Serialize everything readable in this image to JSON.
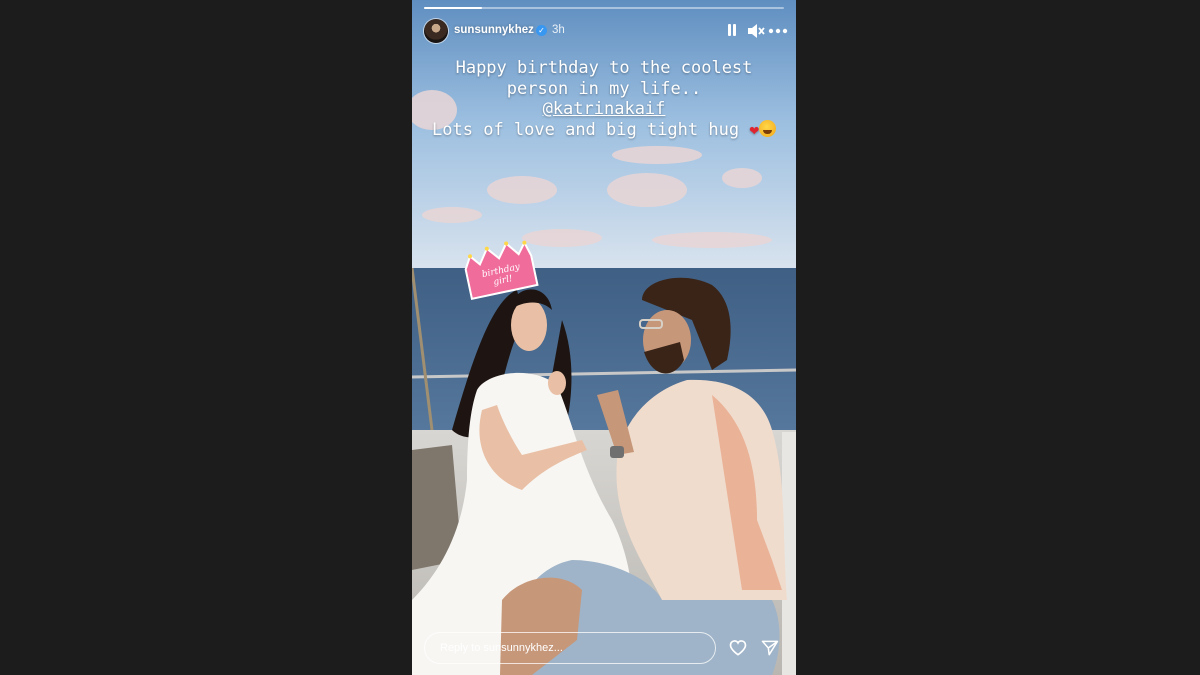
{
  "story": {
    "progress": 0.16,
    "username": "sunsunnykhez",
    "time_ago": "3h",
    "verified_icon": "verified-badge-icon",
    "controls": {
      "pause_icon": "pause-icon",
      "mute_icon": "speaker-muted-icon",
      "more_icon": "more-dots-icon"
    },
    "caption": {
      "line1": "Happy birthday to the coolest",
      "line2": "person in my life..",
      "mention": "@katrinakaif",
      "line4": "Lots of love and big tight hug",
      "heart": "❤"
    },
    "sticker_text": "birthday girl!",
    "reply": {
      "placeholder": "Reply to sunsunnykhez..."
    },
    "like_icon": "heart-outline-icon",
    "send_icon": "send-icon"
  },
  "colors": {
    "page_background": "#1c1c1c",
    "verified_blue": "#3897f0",
    "heart_red": "#e0242f",
    "crown_pink": "#f06c9b"
  }
}
